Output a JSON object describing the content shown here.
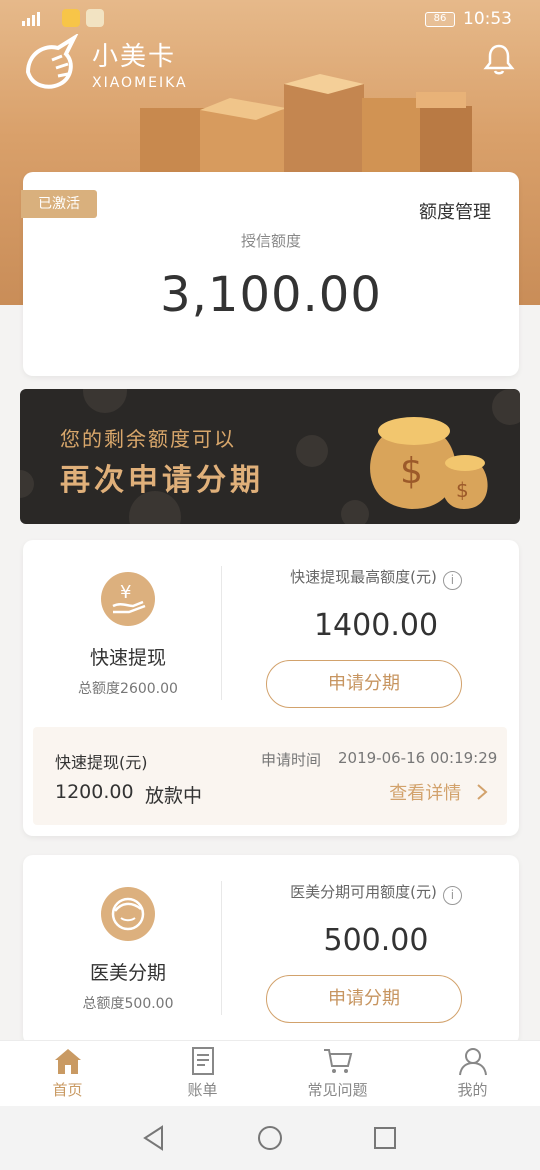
{
  "status_bar": {
    "battery": "86",
    "time": "10:53"
  },
  "header": {
    "logo_cn": "小美卡",
    "logo_en": "XIAOMEIKA"
  },
  "credit": {
    "tag": "已激活",
    "manage_label": "额度管理",
    "label": "授信额度",
    "amount": "3,100.00"
  },
  "banner": {
    "line1": "您的剩余额度可以",
    "line2": "再次申请分期"
  },
  "products": [
    {
      "name": "快速提现",
      "total": "总额度2600.00",
      "max_label": "快速提现最高额度(元)",
      "max_amount": "1400.00",
      "apply_label": "申请分期",
      "loan": {
        "title": "快速提现(元)",
        "time_label": "申请时间",
        "time": "2019-06-16 00:19:29",
        "amount": "1200.00",
        "status": "放款中",
        "detail_label": "查看详情"
      }
    },
    {
      "name": "医美分期",
      "total": "总额度500.00",
      "max_label": "医美分期可用额度(元)",
      "max_amount": "500.00",
      "apply_label": "申请分期"
    }
  ],
  "tabs": [
    {
      "label": "首页",
      "icon": "home-icon",
      "active": true
    },
    {
      "label": "账单",
      "icon": "bill-icon"
    },
    {
      "label": "常见问题",
      "icon": "cart-icon"
    },
    {
      "label": "我的",
      "icon": "user-icon"
    }
  ],
  "colors": {
    "accent": "#d2a26c",
    "hero": "#d9a06a",
    "banner_bg": "#2a2826"
  }
}
